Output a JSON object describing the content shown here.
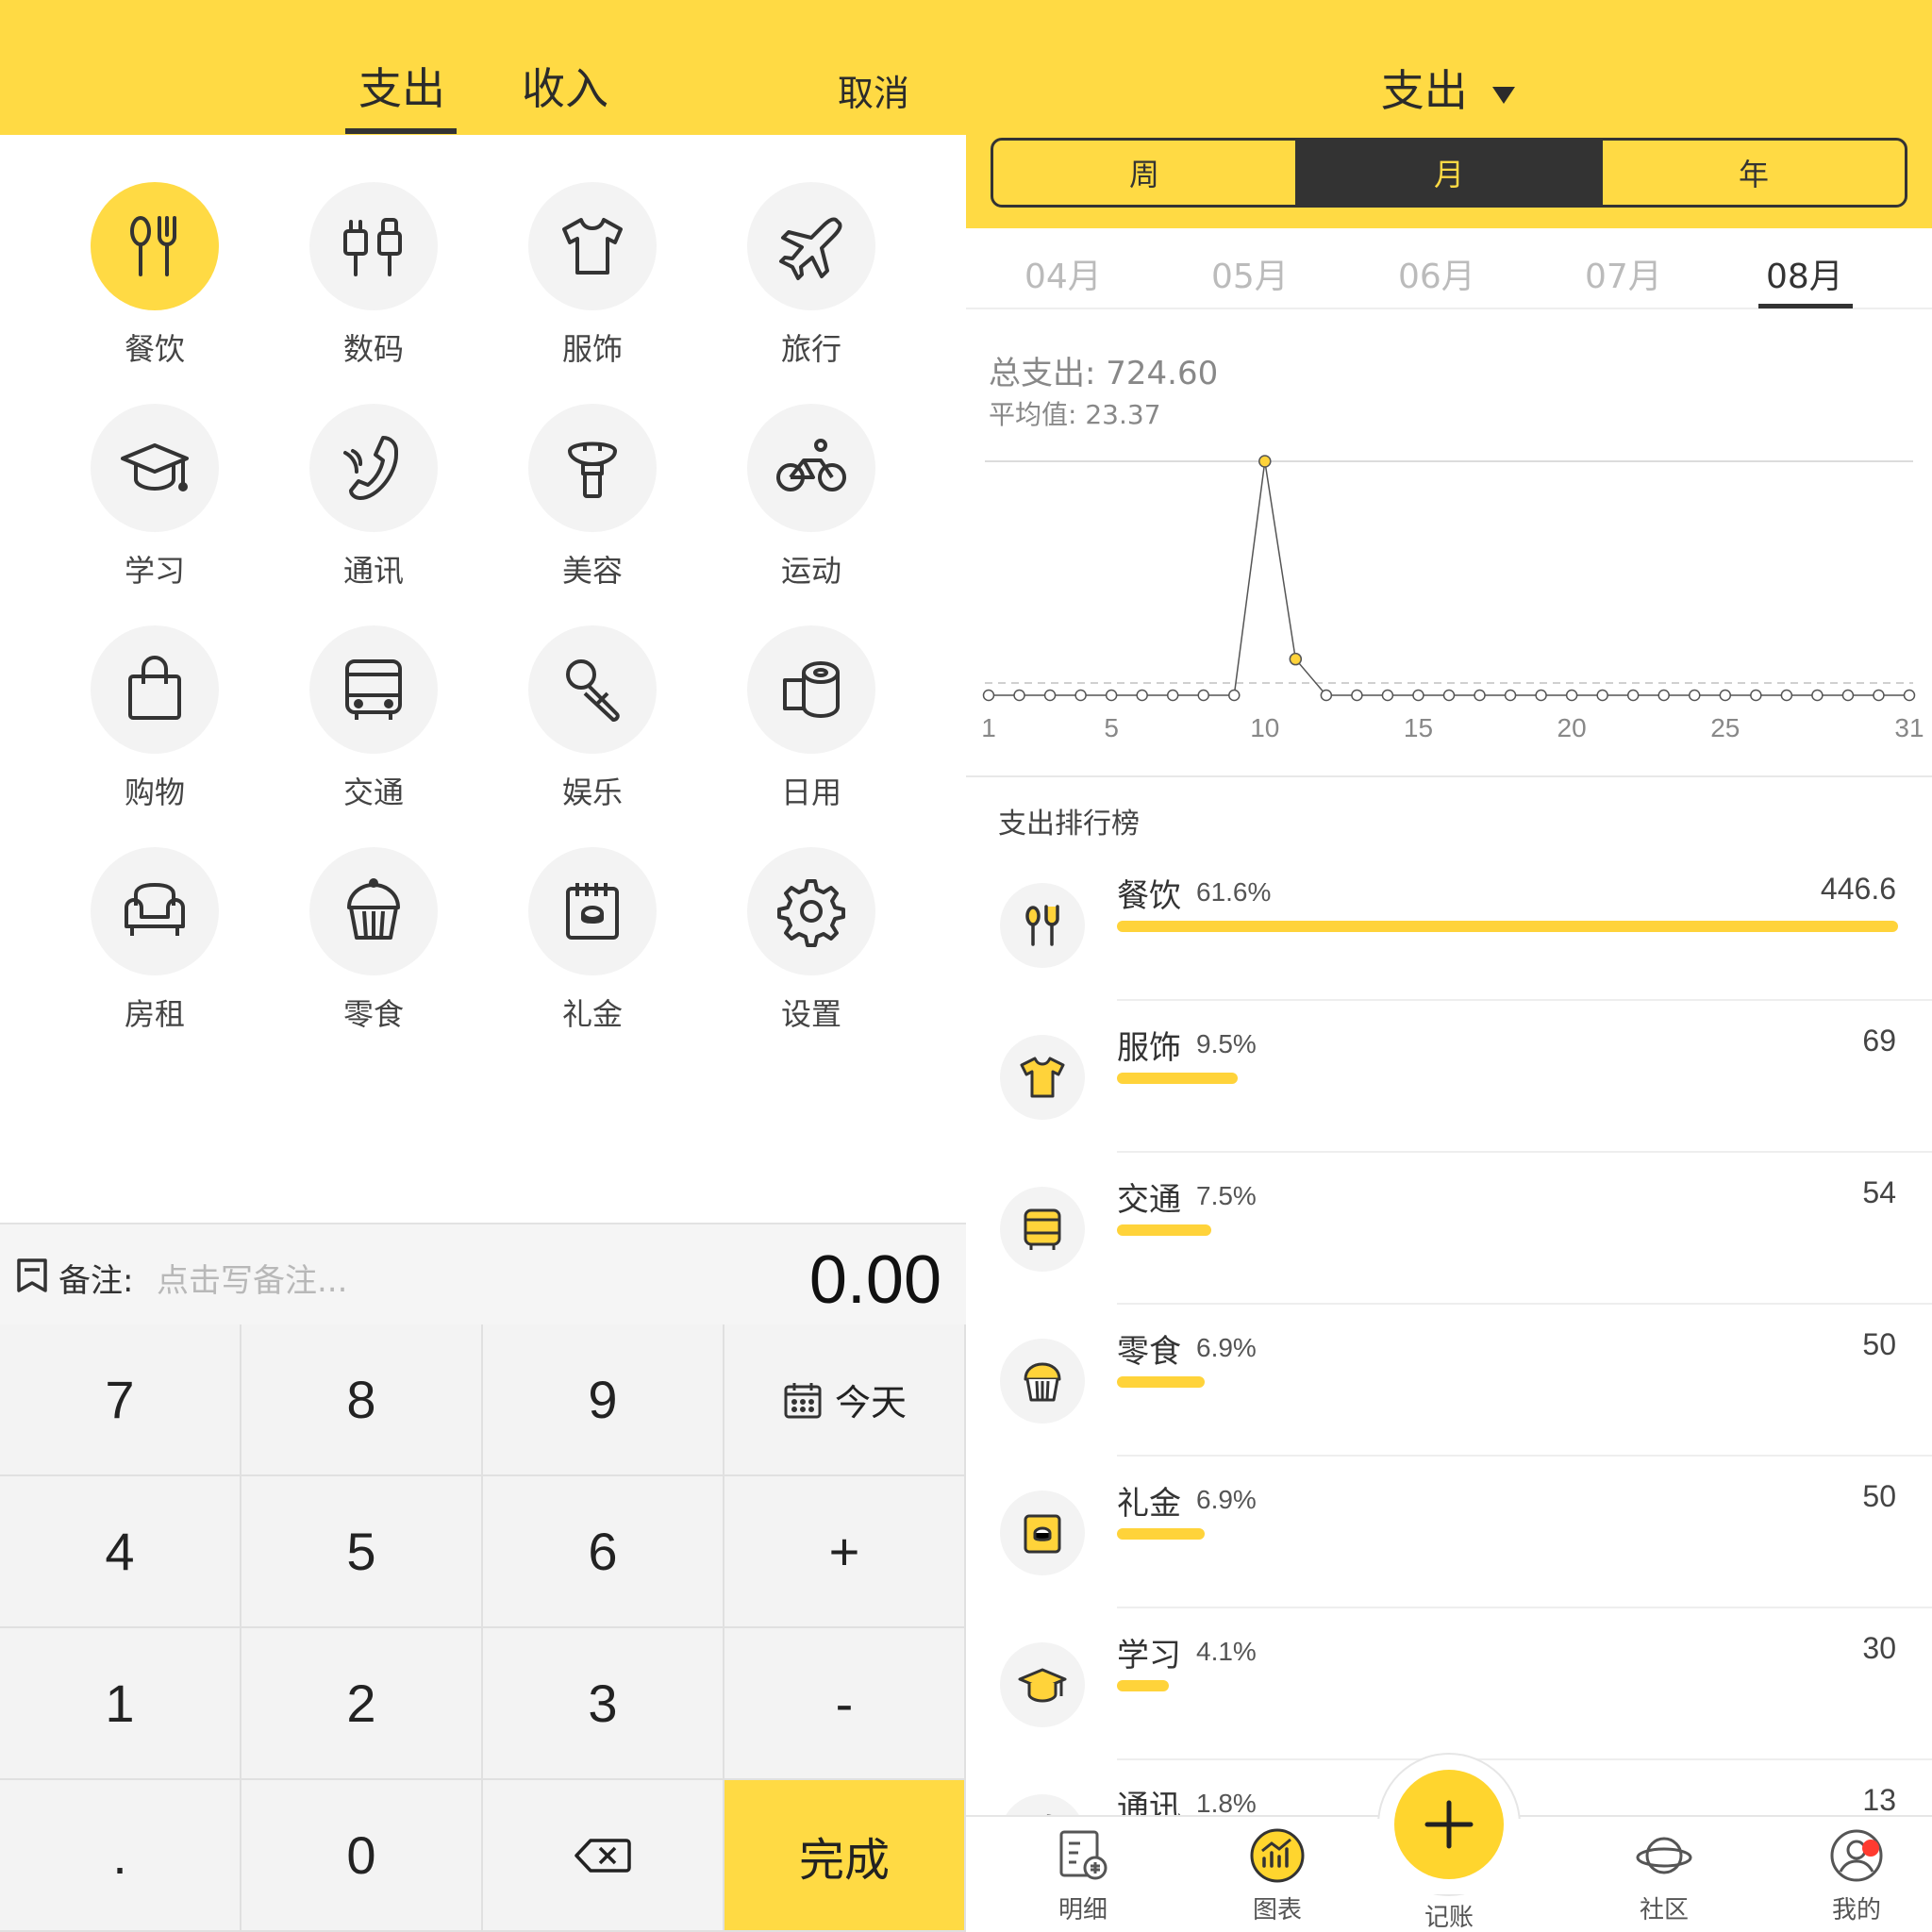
{
  "left": {
    "tabs": [
      "支出",
      "收入"
    ],
    "cancel": "取消",
    "categories": [
      {
        "label": "餐饮",
        "icon": "utensils-icon",
        "active": true
      },
      {
        "label": "数码",
        "icon": "plug-icon"
      },
      {
        "label": "服饰",
        "icon": "tshirt-icon"
      },
      {
        "label": "旅行",
        "icon": "airplane-icon"
      },
      {
        "label": "学习",
        "icon": "graduation-cap-icon"
      },
      {
        "label": "通讯",
        "icon": "phone-icon"
      },
      {
        "label": "美容",
        "icon": "makeup-brush-icon"
      },
      {
        "label": "运动",
        "icon": "bicycle-icon"
      },
      {
        "label": "购物",
        "icon": "shopping-bag-icon"
      },
      {
        "label": "交通",
        "icon": "bus-icon"
      },
      {
        "label": "娱乐",
        "icon": "microphone-icon"
      },
      {
        "label": "日用",
        "icon": "tissue-roll-icon"
      },
      {
        "label": "房租",
        "icon": "armchair-icon"
      },
      {
        "label": "零食",
        "icon": "cupcake-icon"
      },
      {
        "label": "礼金",
        "icon": "red-envelope-icon"
      },
      {
        "label": "设置",
        "icon": "gear-icon"
      }
    ],
    "note_label": "备注:",
    "note_placeholder": "点击写备注...",
    "amount": "0.00",
    "keys": [
      "7",
      "8",
      "9",
      "今天",
      "4",
      "5",
      "6",
      "+",
      "1",
      "2",
      "3",
      "-",
      ".",
      "0",
      "⌫",
      "完成"
    ]
  },
  "right": {
    "title": "支出",
    "segments": [
      "周",
      "月",
      "年"
    ],
    "selected_segment": "月",
    "months": [
      "04月",
      "05月",
      "06月",
      "07月",
      "08月"
    ],
    "selected_month": "08月",
    "total_label": "总支出:",
    "total_value": "724.60",
    "avg_label": "平均值:",
    "avg_value": "23.37",
    "ranking_title": "支出排行榜",
    "ranking": [
      {
        "name": "餐饮",
        "pct": "61.6%",
        "value": "446.6",
        "ratio": 1.0,
        "icon": "utensils-icon"
      },
      {
        "name": "服饰",
        "pct": "9.5%",
        "value": "69",
        "ratio": 0.154,
        "icon": "tshirt-icon"
      },
      {
        "name": "交通",
        "pct": "7.5%",
        "value": "54",
        "ratio": 0.121,
        "icon": "bus-icon"
      },
      {
        "name": "零食",
        "pct": "6.9%",
        "value": "50",
        "ratio": 0.112,
        "icon": "cupcake-icon"
      },
      {
        "name": "礼金",
        "pct": "6.9%",
        "value": "50",
        "ratio": 0.112,
        "icon": "red-envelope-icon"
      },
      {
        "name": "学习",
        "pct": "4.1%",
        "value": "30",
        "ratio": 0.067,
        "icon": "graduation-cap-icon"
      },
      {
        "name": "通讯",
        "pct": "1.8%",
        "value": "13",
        "ratio": 0.03,
        "icon": "phone-icon"
      }
    ],
    "nav": [
      {
        "label": "明细",
        "icon": "list-detail-icon"
      },
      {
        "label": "图表",
        "icon": "chart-icon"
      },
      {
        "label": "记账",
        "icon": "plus-icon"
      },
      {
        "label": "社区",
        "icon": "planet-icon"
      },
      {
        "label": "我的",
        "icon": "user-icon"
      }
    ],
    "colors": {
      "accent": "#FFDA44",
      "dark": "#333333",
      "badge": "#ff3b30"
    }
  },
  "chart_data": {
    "type": "line",
    "title": "",
    "xlabel": "",
    "ylabel": "",
    "x": [
      1,
      2,
      3,
      4,
      5,
      6,
      7,
      8,
      9,
      10,
      11,
      12,
      13,
      14,
      15,
      16,
      17,
      18,
      19,
      20,
      21,
      22,
      23,
      24,
      25,
      26,
      27,
      28,
      29,
      30,
      31
    ],
    "x_ticks": [
      "1",
      "5",
      "10",
      "15",
      "20",
      "25",
      "31"
    ],
    "values": [
      0,
      0,
      0,
      0,
      0,
      0,
      0,
      0,
      0,
      446.6,
      69,
      0,
      0,
      0,
      0,
      0,
      0,
      0,
      0,
      0,
      0,
      0,
      0,
      0,
      0,
      0,
      0,
      0,
      0,
      0,
      0
    ],
    "highlighted_points": [
      10,
      11
    ],
    "average": 23.37,
    "ylim": [
      0,
      446.6
    ],
    "grid": false
  }
}
